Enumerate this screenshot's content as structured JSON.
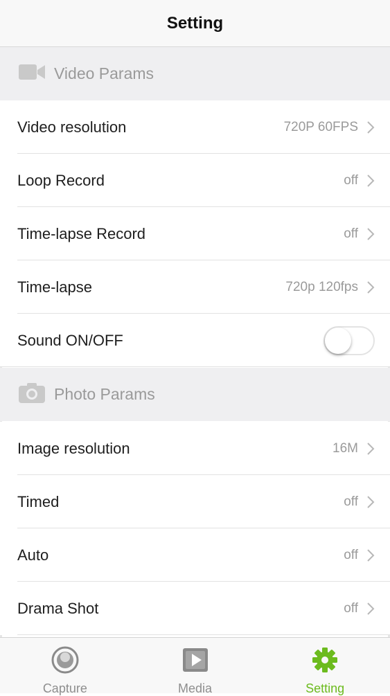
{
  "header": {
    "title": "Setting"
  },
  "sections": [
    {
      "title": "Video Params",
      "icon": "video-camera-icon",
      "rows": [
        {
          "label": "Video resolution",
          "value": "720P 60FPS"
        },
        {
          "label": "Loop Record",
          "value": "off"
        },
        {
          "label": "Time-lapse Record",
          "value": "off"
        },
        {
          "label": "Time-lapse",
          "value": "720p 120fps"
        },
        {
          "label": "Sound ON/OFF",
          "toggle": false
        }
      ]
    },
    {
      "title": "Photo Params",
      "icon": "camera-icon",
      "rows": [
        {
          "label": "Image resolution",
          "value": "16M"
        },
        {
          "label": "Timed",
          "value": "off"
        },
        {
          "label": "Auto",
          "value": "off"
        },
        {
          "label": "Drama Shot",
          "value": "off"
        }
      ]
    }
  ],
  "tabbar": {
    "tabs": [
      {
        "label": "Capture",
        "icon": "capture-icon",
        "active": false
      },
      {
        "label": "Media",
        "icon": "media-play-icon",
        "active": false
      },
      {
        "label": "Setting",
        "icon": "gear-icon",
        "active": true
      }
    ]
  },
  "colors": {
    "accent": "#6cbb1e",
    "muted": "#9a9a9a",
    "section_bg": "#efeff1"
  }
}
